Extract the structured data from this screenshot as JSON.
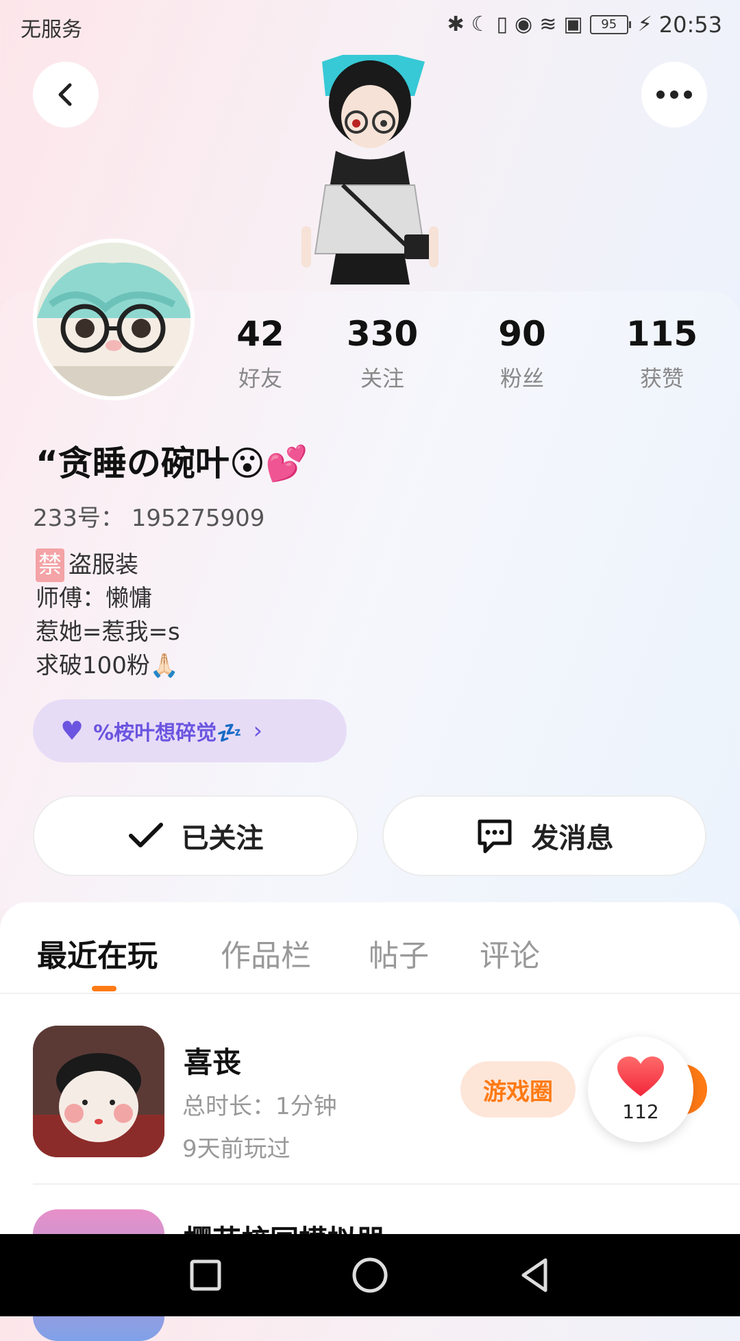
{
  "status_bar": {
    "carrier": "无服务",
    "battery": "95",
    "time": "20:53"
  },
  "profile": {
    "stats": [
      {
        "value": "42",
        "label": "好友"
      },
      {
        "value": "330",
        "label": "关注"
      },
      {
        "value": "90",
        "label": "粉丝"
      },
      {
        "value": "115",
        "label": "获赞"
      }
    ],
    "nickname": "“贪睡の碗叶😮💕",
    "uid": "233号：  195275909",
    "bio_ban_tag": "禁",
    "bio_lines": [
      "盗服装",
      "师傅：懒慵",
      "惹她=惹我=s",
      "求破100粉🙏🏻"
    ],
    "group_pill": "%桉叶想碎觉💤"
  },
  "actions": {
    "follow_label": "已关注",
    "message_label": "发消息"
  },
  "tabs": [
    {
      "label": "最近在玩",
      "active": true
    },
    {
      "label": "作品栏",
      "active": false
    },
    {
      "label": "帖子",
      "active": false
    },
    {
      "label": "评论",
      "active": false
    }
  ],
  "recent_games": [
    {
      "name": "喜丧",
      "total_time": "总时长：1分钟",
      "last_played": "9天前玩过",
      "circle_button": "游戏圈",
      "likes": "112"
    },
    {
      "name": "樱花校园模拟器..."
    }
  ],
  "colors": {
    "accent": "#ff7a14",
    "group_purple": "#6b55e0",
    "pill_bg": "#e7dcf6"
  }
}
